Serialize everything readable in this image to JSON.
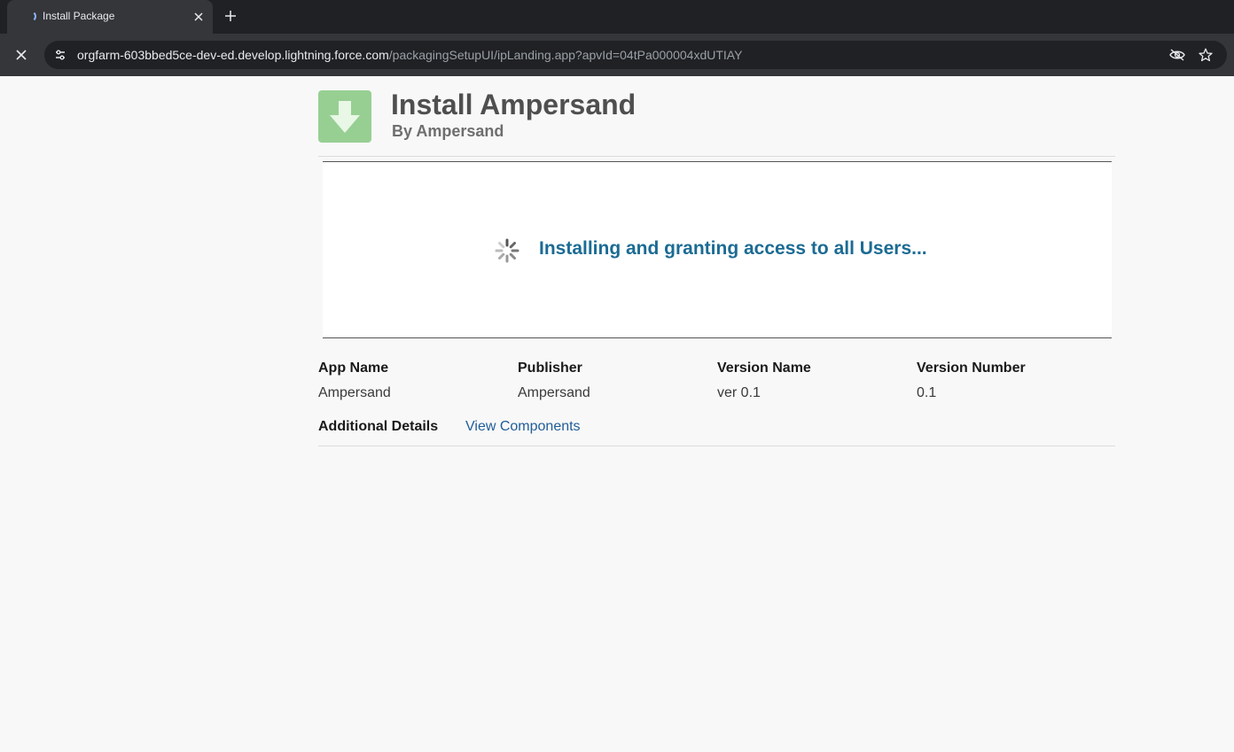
{
  "browser": {
    "tab_title": "Install Package",
    "url_host": "orgfarm-603bbed5ce-dev-ed.develop.lightning.force.com",
    "url_path": "/packagingSetupUI/ipLanding.app?apvId=04tPa000004xdUTIAY"
  },
  "header": {
    "title": "Install Ampersand",
    "subtitle": "By Ampersand",
    "icon": "download-arrow-icon",
    "icon_color": "#97cf93"
  },
  "status": {
    "message": "Installing and granting access to all Users...",
    "color": "#1b6b93"
  },
  "details": {
    "columns": [
      {
        "label": "App Name",
        "value": "Ampersand"
      },
      {
        "label": "Publisher",
        "value": "Ampersand"
      },
      {
        "label": "Version Name",
        "value": "ver 0.1"
      },
      {
        "label": "Version Number",
        "value": "0.1"
      }
    ],
    "additional_label": "Additional Details",
    "view_components_link": "View Components"
  }
}
